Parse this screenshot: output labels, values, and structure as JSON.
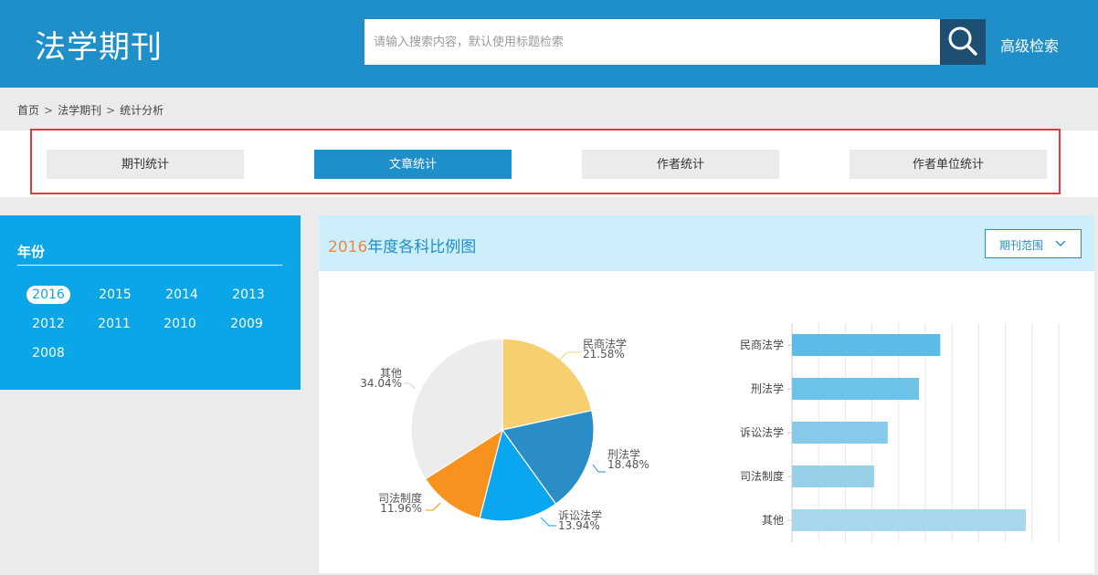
{
  "header": {
    "logo": "法学期刊",
    "search_placeholder": "请输入搜索内容，默认使用标题检索",
    "advanced_search": "高级检索"
  },
  "breadcrumb": [
    "首页",
    "法学期刊",
    "统计分析"
  ],
  "tabs": [
    {
      "label": "期刊统计",
      "active": false
    },
    {
      "label": "文章统计",
      "active": true
    },
    {
      "label": "作者统计",
      "active": false
    },
    {
      "label": "作者单位统计",
      "active": false
    }
  ],
  "year_panel": {
    "title": "年份",
    "years": [
      "2016",
      "2015",
      "2014",
      "2013",
      "2012",
      "2011",
      "2010",
      "2009",
      "2008"
    ],
    "selected": "2016"
  },
  "chart_panel": {
    "title_year": "2016",
    "title_suffix": "年度各科比例图",
    "range_button": "期刊范围",
    "range_icon": "chevron-down-icon"
  },
  "colors": {
    "header_bg": "#1f8fc9",
    "year_panel_bg": "#0aa6e8",
    "highlight": "#e03a3a",
    "title_year": "#f08a3c"
  },
  "chart_data": [
    {
      "type": "pie",
      "categories": [
        "民商法学",
        "刑法学",
        "诉讼法学",
        "司法制度",
        "其他"
      ],
      "values": [
        21.58,
        18.48,
        13.94,
        11.96,
        34.04
      ],
      "labels": [
        "21.58%",
        "18.48%",
        "13.94%",
        "11.96%",
        "34.04%"
      ],
      "colors": [
        "#f6d06f",
        "#2a8dc5",
        "#0aa6f0",
        "#f7921e",
        "#ececec"
      ]
    },
    {
      "type": "bar",
      "orientation": "horizontal",
      "categories": [
        "民商法学",
        "刑法学",
        "诉讼法学",
        "司法制度",
        "其他"
      ],
      "values": [
        21.58,
        18.48,
        13.94,
        11.96,
        34.04
      ],
      "colors": [
        "#5bbce8",
        "#6dc2e8",
        "#86c9e8",
        "#98d0ea",
        "#a9d7ee"
      ],
      "grid": true
    }
  ]
}
